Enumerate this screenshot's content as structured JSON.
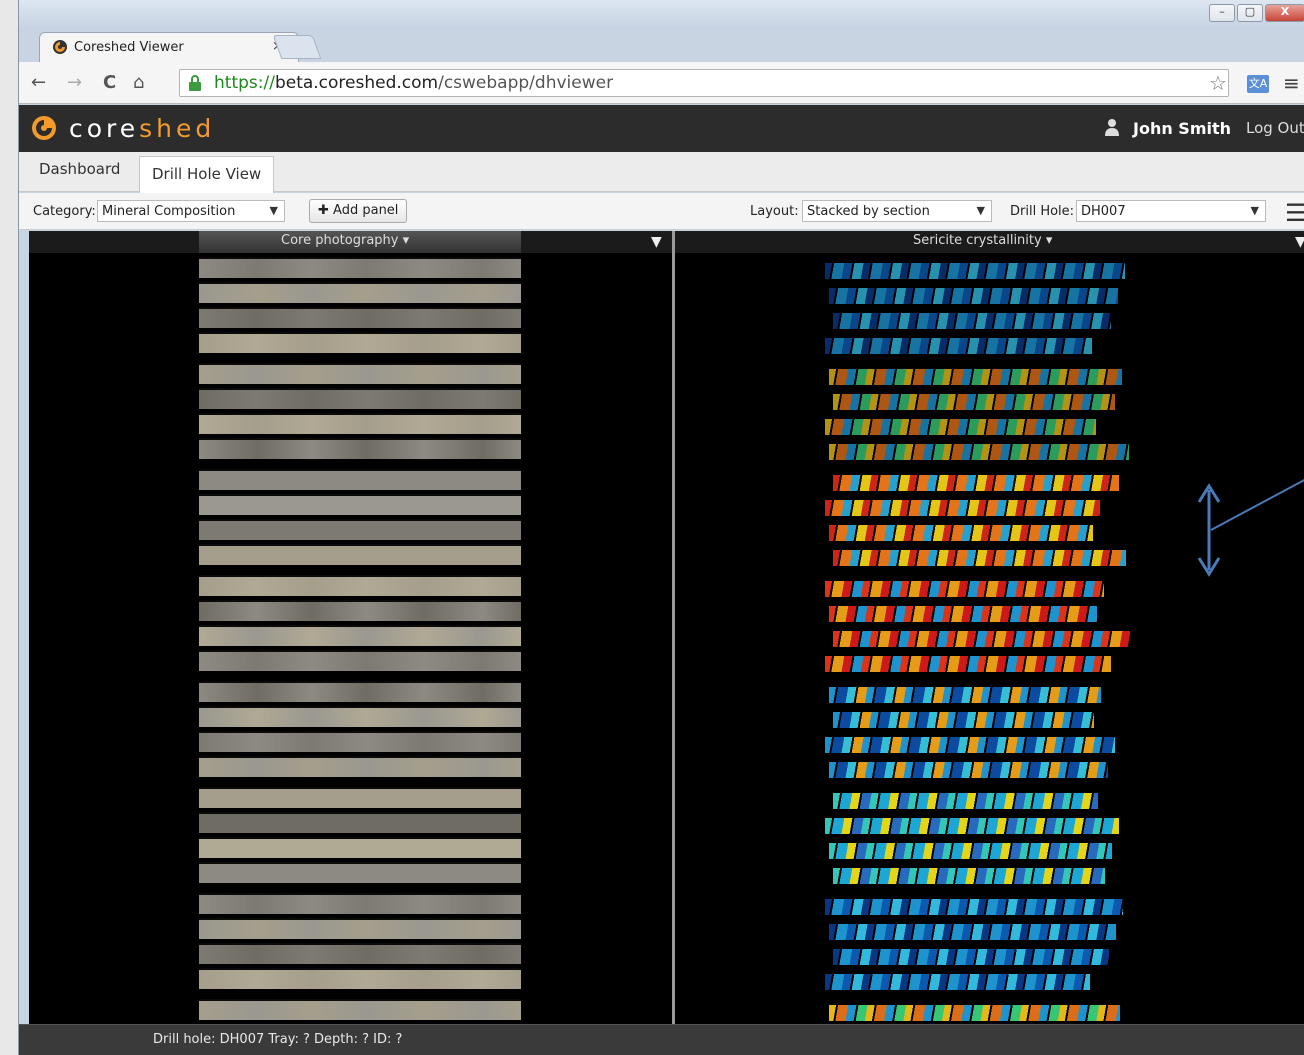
{
  "browser": {
    "tab_title": "Coreshed Viewer",
    "tab_close": "×",
    "url_scheme": "https://",
    "url_host": "beta.coreshed.com",
    "url_path": "/cswebapp/dhviewer",
    "window_controls": {
      "minimize": "–",
      "maximize": "▢",
      "close": "X"
    },
    "nav": {
      "back": "←",
      "forward": "→",
      "reload": "C",
      "home": "⌂"
    },
    "icons": [
      "favicon-icon",
      "lock-icon",
      "bookmark-star-icon",
      "translate-icon",
      "menu-icon"
    ]
  },
  "app": {
    "brand_part1": "core",
    "brand_part2": "shed",
    "user_name": "John Smith",
    "logout_label": "Log Out",
    "tabs": [
      {
        "label": "Dashboard",
        "active": false
      },
      {
        "label": "Drill Hole View",
        "active": true
      }
    ],
    "toolbar": {
      "category_label": "Category:",
      "category_value": "Mineral Composition",
      "add_panel_label": "Add panel",
      "layout_label": "Layout:",
      "layout_value": "Stacked by section",
      "drillhole_label": "Drill Hole:",
      "drillhole_value": "DH007"
    },
    "panels": [
      {
        "title": "Core photography",
        "dropdown": "▾"
      },
      {
        "title": "Sericite crystallinity",
        "dropdown": "▾"
      }
    ],
    "status_text": "Drill hole: DH007 Tray: ? Depth: ? ID: ?",
    "colors": {
      "header_bg": "#2c2c2c",
      "brand_accent": "#f39a2c",
      "panel_bg": "#000000",
      "status_bg": "#3a3a3a",
      "url_green": "#1a8a1a",
      "annotation_arrow": "#4a7ab8"
    }
  }
}
